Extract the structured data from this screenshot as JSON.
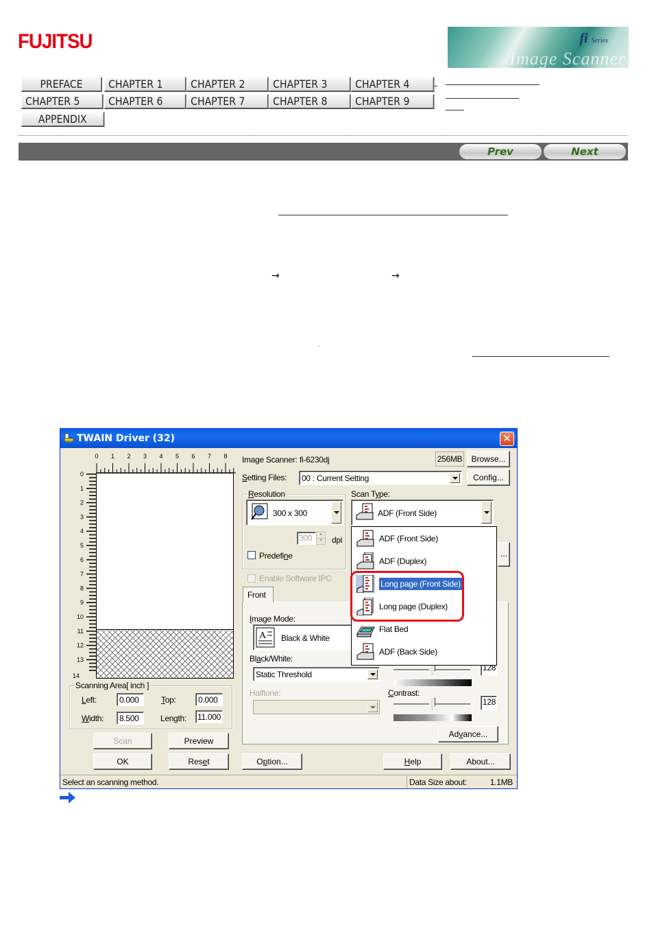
{
  "header": {
    "logo_text": "FUJITSU",
    "banner_brand": "fi",
    "banner_series": "Series",
    "banner_word": "Image Scanner"
  },
  "nav": {
    "buttons": [
      "PREFACE",
      "CHAPTER 1",
      "CHAPTER 2",
      "CHAPTER 3",
      "CHAPTER 4",
      "CHAPTER 5",
      "CHAPTER 6",
      "CHAPTER 7",
      "CHAPTER 8",
      "CHAPTER 9",
      "APPENDIX"
    ],
    "prev_label": "Prev",
    "next_label": "Next"
  },
  "body": {
    "arrow_glyph": "→",
    "continue_icon": "right-arrow-icon"
  },
  "dialog": {
    "title": "TWAIN Driver (32)",
    "close_label": "✕",
    "ruler_top_labels": [
      "0",
      "1",
      "2",
      "3",
      "4",
      "5",
      "6",
      "7",
      "8"
    ],
    "ruler_left_labels": [
      "0",
      "1",
      "2",
      "3",
      "4",
      "5",
      "6",
      "7",
      "8",
      "9",
      "10",
      "11",
      "12",
      "13",
      "14"
    ],
    "scanning_area": {
      "title": "Scanning Area[ inch ]",
      "left_label": "Left:",
      "left_value": "0.000",
      "top_label": "Top:",
      "top_value": "0.000",
      "width_label": "Width:",
      "width_value": "8.500",
      "length_label": "Length:",
      "length_value": "11.000"
    },
    "scan_button": "Scan",
    "preview_button": "Preview",
    "ok_button": "OK",
    "reset_button": "Reset",
    "image_scanner_label": "Image Scanner:",
    "image_scanner_value": "fi-6230dj",
    "memory_value": "256MB",
    "browse_button": "Browse...",
    "setting_files_label": "Setting Files:",
    "setting_files_value": "00 : Current Setting",
    "config_button": "Config...",
    "resolution": {
      "title": "Resolution",
      "value": "300 x 300",
      "dpi_value": "300",
      "dpi_unit": "dpi",
      "predefine_label": "Predefine",
      "predefine_checked": false
    },
    "scan_type": {
      "label": "Scan Type:",
      "selected": "ADF (Front Side)",
      "options": [
        {
          "label": "ADF (Front Side)",
          "icon": "adf-front-icon"
        },
        {
          "label": "ADF (Duplex)",
          "icon": "adf-duplex-icon"
        },
        {
          "label": "Long page (Front Side)",
          "icon": "long-page-front-icon",
          "highlighted": true
        },
        {
          "label": "Long page (Duplex)",
          "icon": "long-page-duplex-icon"
        },
        {
          "label": "Flat Bed",
          "icon": "flatbed-icon"
        },
        {
          "label": "ADF (Back Side)",
          "icon": "adf-back-icon"
        }
      ]
    },
    "ellipsis_button": "...",
    "enable_ipc_label": "Enable Software IPC",
    "tab_front": "Front",
    "image_mode_label": "Image Mode:",
    "image_mode_value": "Black & White",
    "bw_label": "Black/White:",
    "bw_value": "Static Threshold",
    "halftone_label": "Halftone:",
    "halftone_value": "",
    "brightness_value": "128",
    "contrast_label": "Contrast:",
    "contrast_value": "128",
    "advance_button": "Advance...",
    "option_button": "Option...",
    "help_button": "Help",
    "about_button": "About...",
    "status_text": "Select an scanning method.",
    "data_size_label": "Data Size about:",
    "data_size_value": "1.1MB"
  }
}
